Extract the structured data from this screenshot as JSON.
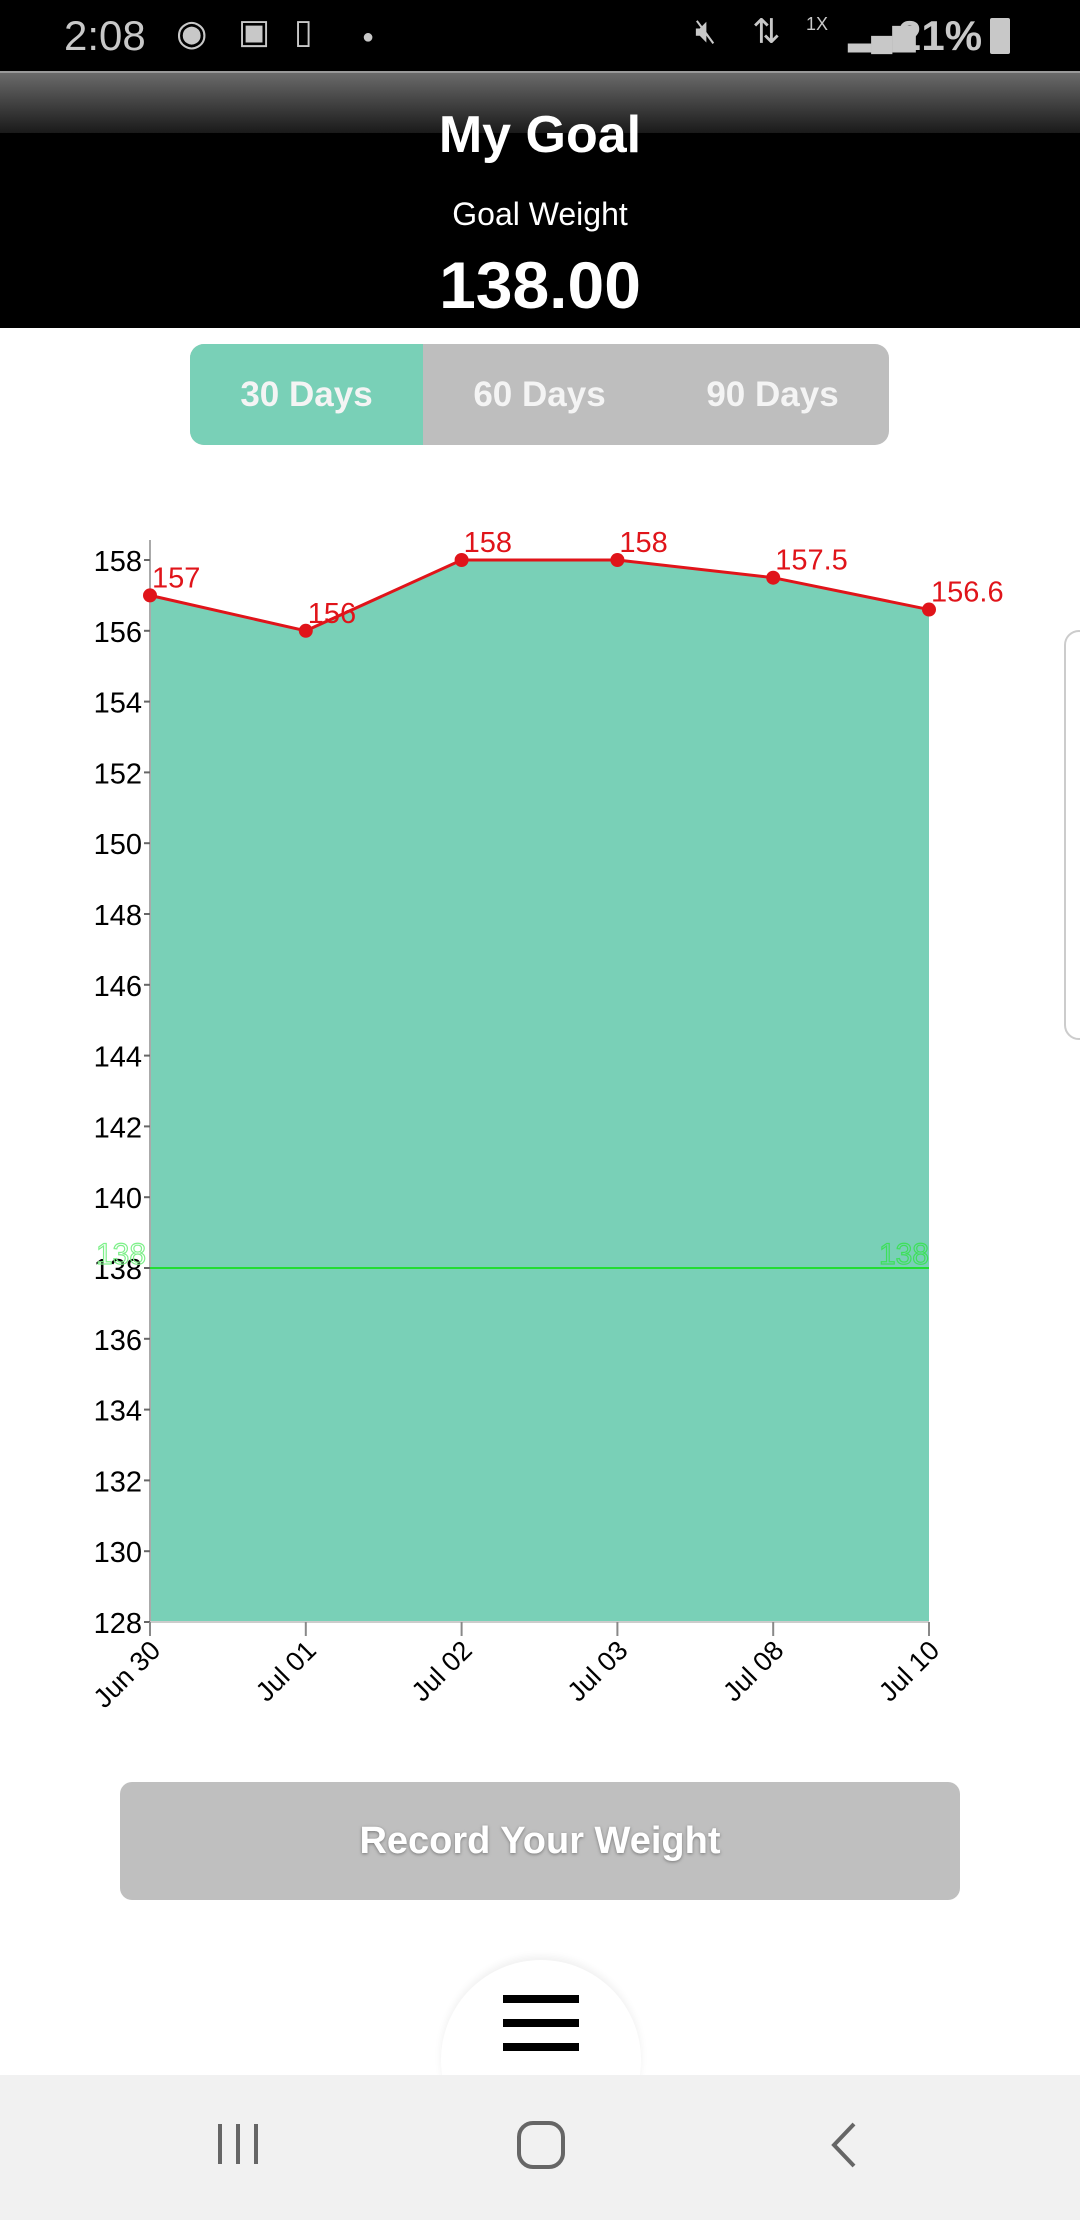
{
  "status_bar": {
    "time": "2:08",
    "battery": "21%",
    "network": "1X"
  },
  "header": {
    "title": "My Goal",
    "subtitle": "Goal Weight",
    "goal_value": "138.00"
  },
  "range_tabs": [
    {
      "label": "30 Days",
      "active": true
    },
    {
      "label": "60 Days",
      "active": false
    },
    {
      "label": "90 Days",
      "active": false
    }
  ],
  "colors": {
    "accent": "#79d0b7",
    "line": "#e0141a",
    "goal_line": "#22dd33",
    "inactive": "#bebebe"
  },
  "chart_data": {
    "type": "area",
    "categories": [
      "Jun 30",
      "Jul 01",
      "Jul 02",
      "Jul 03",
      "Jul 08",
      "Jul 10"
    ],
    "values": [
      157,
      156,
      158,
      158,
      157.5,
      156.6
    ],
    "data_labels": [
      "157",
      "156",
      "158",
      "158",
      "157.5",
      "156.6"
    ],
    "ylim": [
      128,
      158
    ],
    "yticks": [
      "128",
      "130",
      "132",
      "134",
      "136",
      "138",
      "140",
      "142",
      "144",
      "146",
      "148",
      "150",
      "152",
      "154",
      "156",
      "158"
    ],
    "goal_line": {
      "value": 138,
      "label": "138"
    },
    "grid": false
  },
  "record_button": "Record Your Weight",
  "icons": {
    "menu": "hamburger-icon",
    "nav": [
      "recent-apps-icon",
      "home-icon",
      "back-icon"
    ]
  }
}
